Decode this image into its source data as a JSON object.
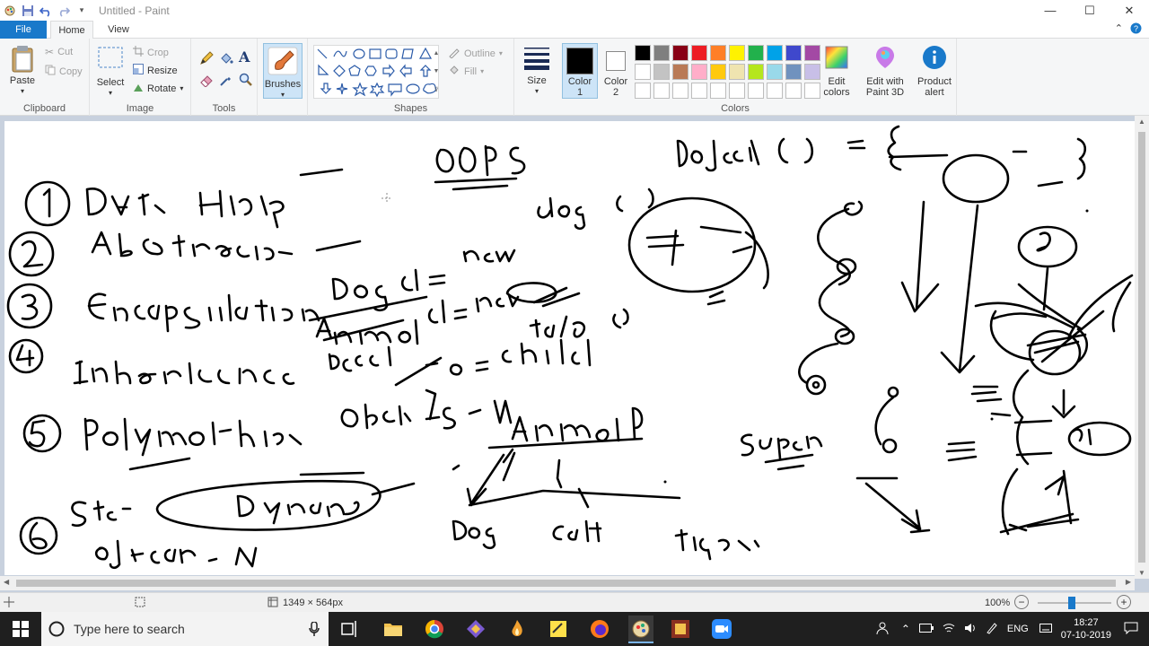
{
  "titlebar": {
    "title": "Untitled - Paint",
    "buttons": [
      "minimize",
      "maximize",
      "close"
    ]
  },
  "tabs": {
    "file": "File",
    "home": "Home",
    "view": "View"
  },
  "ribbon": {
    "clipboard": {
      "paste": "Paste",
      "cut": "Cut",
      "copy": "Copy",
      "label": "Clipboard"
    },
    "image": {
      "select": "Select",
      "crop": "Crop",
      "resize": "Resize",
      "rotate": "Rotate",
      "label": "Image"
    },
    "tools": {
      "label": "Tools"
    },
    "brushes": {
      "label": "Brushes"
    },
    "shapes": {
      "outline": "Outline",
      "fill": "Fill",
      "label": "Shapes"
    },
    "size": {
      "label": "Size"
    },
    "color1": {
      "line1": "Color",
      "line2": "1"
    },
    "color2": {
      "line1": "Color",
      "line2": "2"
    },
    "colors": {
      "label": "Colors",
      "row1": [
        "#000000",
        "#7f7f7f",
        "#880015",
        "#ed1c24",
        "#ff7f27",
        "#fff200",
        "#22b14c",
        "#00a2e8",
        "#3f48cc",
        "#a349a4"
      ],
      "row2": [
        "#ffffff",
        "#c3c3c3",
        "#b97a57",
        "#ffaec9",
        "#ffc90e",
        "#efe4b0",
        "#b5e61d",
        "#99d9ea",
        "#7092be",
        "#c8bfe7"
      ],
      "row3": [
        "#ffffff",
        "#ffffff",
        "#ffffff",
        "#ffffff",
        "#ffffff",
        "#ffffff",
        "#ffffff",
        "#ffffff",
        "#ffffff",
        "#ffffff"
      ]
    },
    "edit_colors": {
      "line1": "Edit",
      "line2": "colors"
    },
    "paint3d": {
      "line1": "Edit with",
      "line2": "Paint 3D"
    },
    "product_alert": {
      "line1": "Product",
      "line2": "alert"
    }
  },
  "statusbar": {
    "size": "1349 × 564px",
    "zoom": "100%",
    "zoom_minus": "−",
    "zoom_plus": "+"
  },
  "taskbar": {
    "search_placeholder": "Type here to search",
    "lang": "ENG",
    "time": "18:27",
    "date": "07-10-2019"
  }
}
